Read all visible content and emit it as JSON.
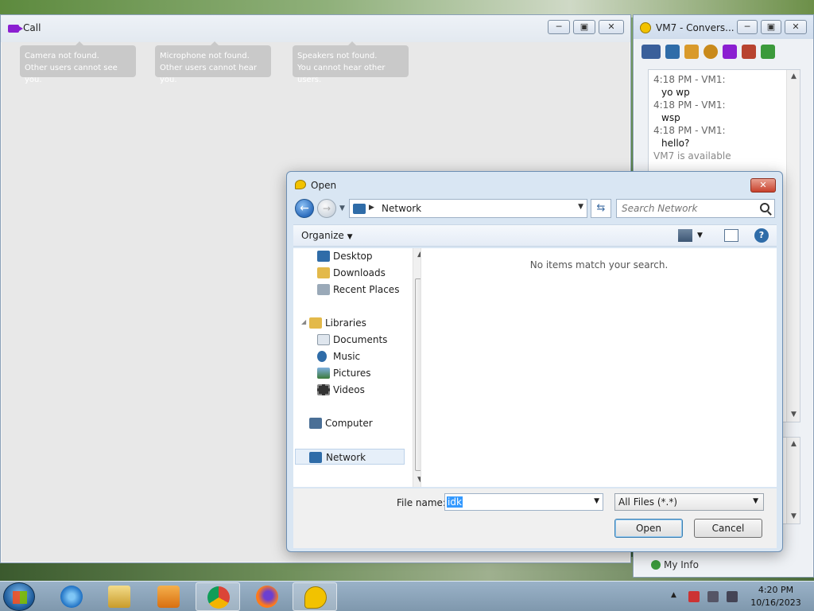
{
  "call_window": {
    "title": "Call",
    "tips": [
      {
        "line1": "Camera not found.",
        "line2": "Other users cannot see you."
      },
      {
        "line1": "Microphone not found.",
        "line2": "Other users cannot hear you."
      },
      {
        "line1": "Speakers not found.",
        "line2": "You cannot hear other users."
      }
    ]
  },
  "conversation_window": {
    "title": "VM7 - Convers...",
    "messages": [
      {
        "meta": "4:18 PM - VM1:",
        "text": "yo wp"
      },
      {
        "meta": "4:18 PM - VM1:",
        "text": "wsp"
      },
      {
        "meta": "4:18 PM - VM1:",
        "text": "hello?"
      }
    ],
    "status": "VM7 is available",
    "my_info": "My Info"
  },
  "open_dialog": {
    "title": "Open",
    "address": "Network",
    "search_placeholder": "Search Network",
    "organize": "Organize",
    "nav_items": {
      "desktop": "Desktop",
      "downloads": "Downloads",
      "recent": "Recent Places",
      "libraries": "Libraries",
      "documents": "Documents",
      "music": "Music",
      "pictures": "Pictures",
      "videos": "Videos",
      "computer": "Computer",
      "network": "Network"
    },
    "empty_message": "No items match your search.",
    "file_name_label": "File name:",
    "file_name_value": "idk",
    "file_type": "All Files (*.*)",
    "open_label": "Open",
    "cancel_label": "Cancel"
  },
  "taskbar": {
    "time": "4:20 PM",
    "date": "10/16/2023"
  },
  "colors": {
    "accent": "#3399ff",
    "camera_purple": "#8b1fd1",
    "close_red": "#c8412d"
  }
}
